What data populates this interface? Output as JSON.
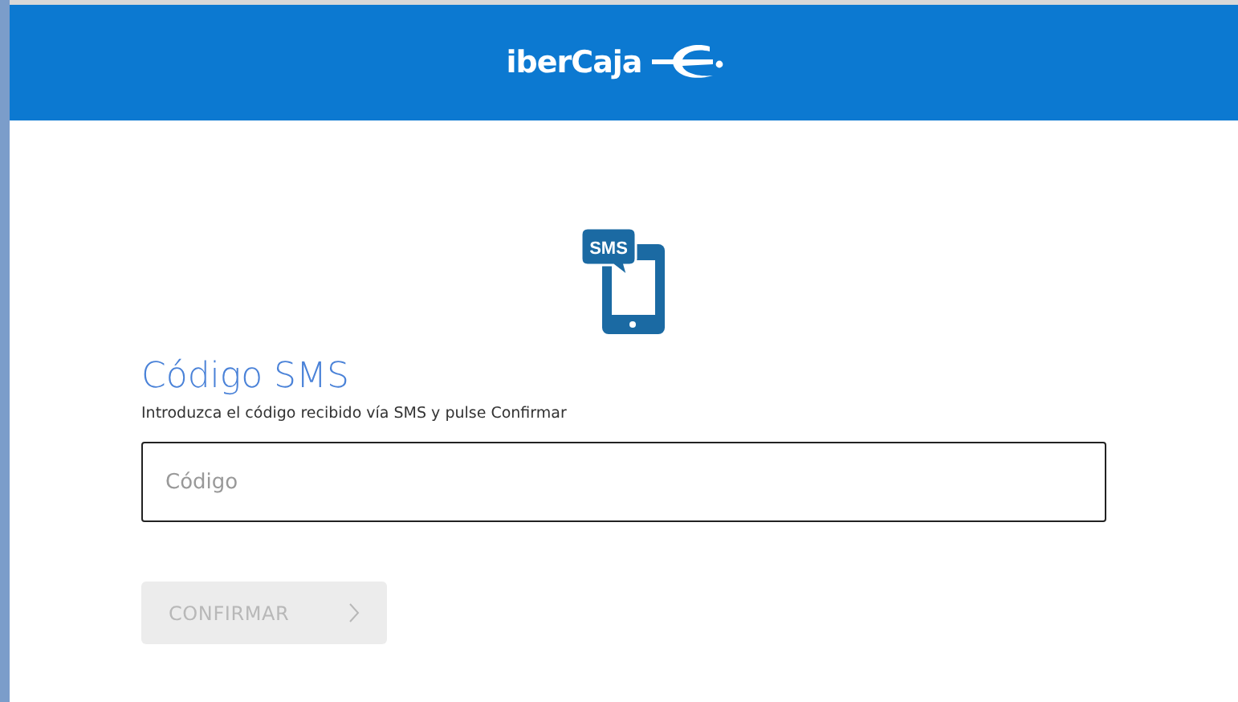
{
  "header": {
    "logo_text": "iberCaja"
  },
  "sms_icon": {
    "label": "SMS"
  },
  "form": {
    "title": "Código SMS",
    "subtitle": "Introduzca el código recibido vía SMS y pulse Confirmar",
    "code_field": {
      "placeholder": "Código"
    },
    "confirm_button": {
      "label": "CONFIRMAR",
      "disabled": true
    }
  }
}
